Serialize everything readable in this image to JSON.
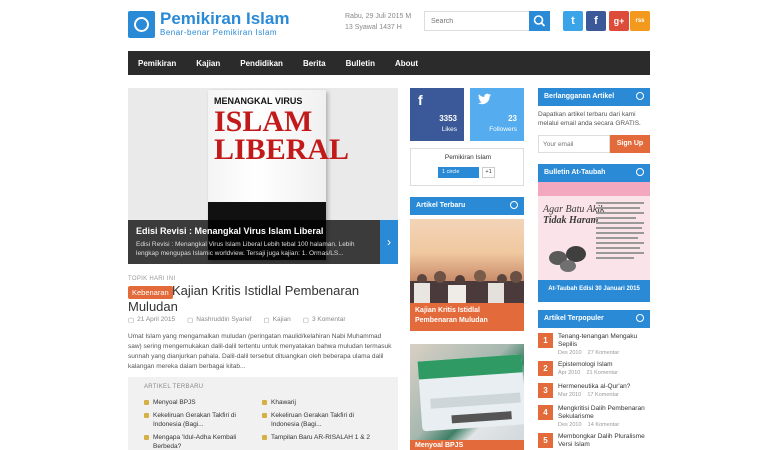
{
  "header": {
    "title": "Pemikiran Islam",
    "tagline": "Benar-benar Pemikiran Islam",
    "date_line1": "Rabu, 29 Juli 2015 M",
    "date_line2": "13 Syawal 1437 H",
    "search_placeholder": "Search",
    "social": {
      "twitter": "t",
      "facebook": "f",
      "gplus": "g+",
      "rss": "rss"
    }
  },
  "nav": [
    "Pemikiran",
    "Kajian",
    "Pendidikan",
    "Berita",
    "Bulletin",
    "About"
  ],
  "slider": {
    "book_top": "MENANGKAL VIRUS",
    "book_big1": "ISLAM",
    "book_big2": "LIBERAL",
    "caption_title": "Edisi Revisi : Menangkal Virus Islam Liberal",
    "caption_desc": "Edisi Revisi : Menangkal Virus Islam Liberal Lebih tebal 100 halaman. Lebih lengkap mengupas Islamic worldview. Tersaji juga kajian: 1.        Ormas/LS...",
    "next": "›"
  },
  "post": {
    "topik": "TOPIK HARI INI",
    "badge": "Kebenaran",
    "title": "Kajian Kritis Istidlal Pembenaran Muludan",
    "date": "21 April 2015",
    "author": "Nashruddin Syarief",
    "category": "Kajian",
    "comments": "3 Komentar",
    "excerpt": "Umat Islam yang mengamalkan muludan (peringatan maulid/kelahiran Nabi Muhammad saw) sering mengemukakan dalil-dalil tertentu untuk menyatakan bahwa muludan termasuk sunnah yang dianjurkan pahala. Dalil-dalil tersebut dituangkan oleh beberapa ulama dalil kalangan mereka dalam berbagai kitab..."
  },
  "related": {
    "heading": "ARTIKEL TERBARU",
    "left": [
      "Menyoal BPJS",
      "Kekeliruan Gerakan Takfiri di Indonesia (Bagi...",
      "Mengapa 'Idul-Adha Kembali Berbeda?"
    ],
    "right": [
      "Khawarij",
      "Kekeliruan Gerakan Takfiri di Indonesia (Bagi...",
      "Tampilan Baru AR-RISALAH 1 & 2"
    ]
  },
  "counters": {
    "facebook_count": "3353",
    "facebook_label": "Likes",
    "twitter_count": "23",
    "twitter_label": "Followers"
  },
  "gplus_widget": {
    "name": "Pemikiran Islam",
    "follow": "1 circle",
    "plus": "+1"
  },
  "artikel_terbaru": {
    "heading": "Artikel Terbaru",
    "item1": "Kajian Kritis Istidlal Pembenaran Muludan",
    "item2": "Menyoal BPJS"
  },
  "subscribe": {
    "heading": "Berlangganan Artikel",
    "text": "Dapatkan artikel terbaru dari kami melalui email anda secara GRATIS.",
    "email_placeholder": "Your email",
    "button": "Sign Up"
  },
  "bulletin": {
    "heading": "Bulletin At-Taubah",
    "img_title1": "Agar Batu Akik",
    "img_title2": "Tidak Haram",
    "img_caption": "At-Taubah Edisi 30 Januari 2015"
  },
  "popular": {
    "heading": "Artikel Terpopuler",
    "items": [
      {
        "num": "1",
        "title": "Tenang-tenangan Mengaku Sepilis",
        "date": "Des 2010",
        "comments": "27 Komentar"
      },
      {
        "num": "2",
        "title": "Epistemologi Islam",
        "date": "Apr 2010",
        "comments": "21 Komentar"
      },
      {
        "num": "3",
        "title": "Hermeneutika al-Qur'an?",
        "date": "Mar 2010",
        "comments": "17 Komentar"
      },
      {
        "num": "4",
        "title": "Mengkritisi Dalih Pembenaran Sekularisme",
        "date": "Des 2010",
        "comments": "14 Komentar"
      },
      {
        "num": "5",
        "title": "Membongkar Dalih Pluralisme Versi Islam",
        "date": "",
        "comments": ""
      }
    ]
  },
  "colors": {
    "brand": "#2a8ad6",
    "accent": "#e36b3b",
    "nav_bg": "#2b2b2b"
  }
}
